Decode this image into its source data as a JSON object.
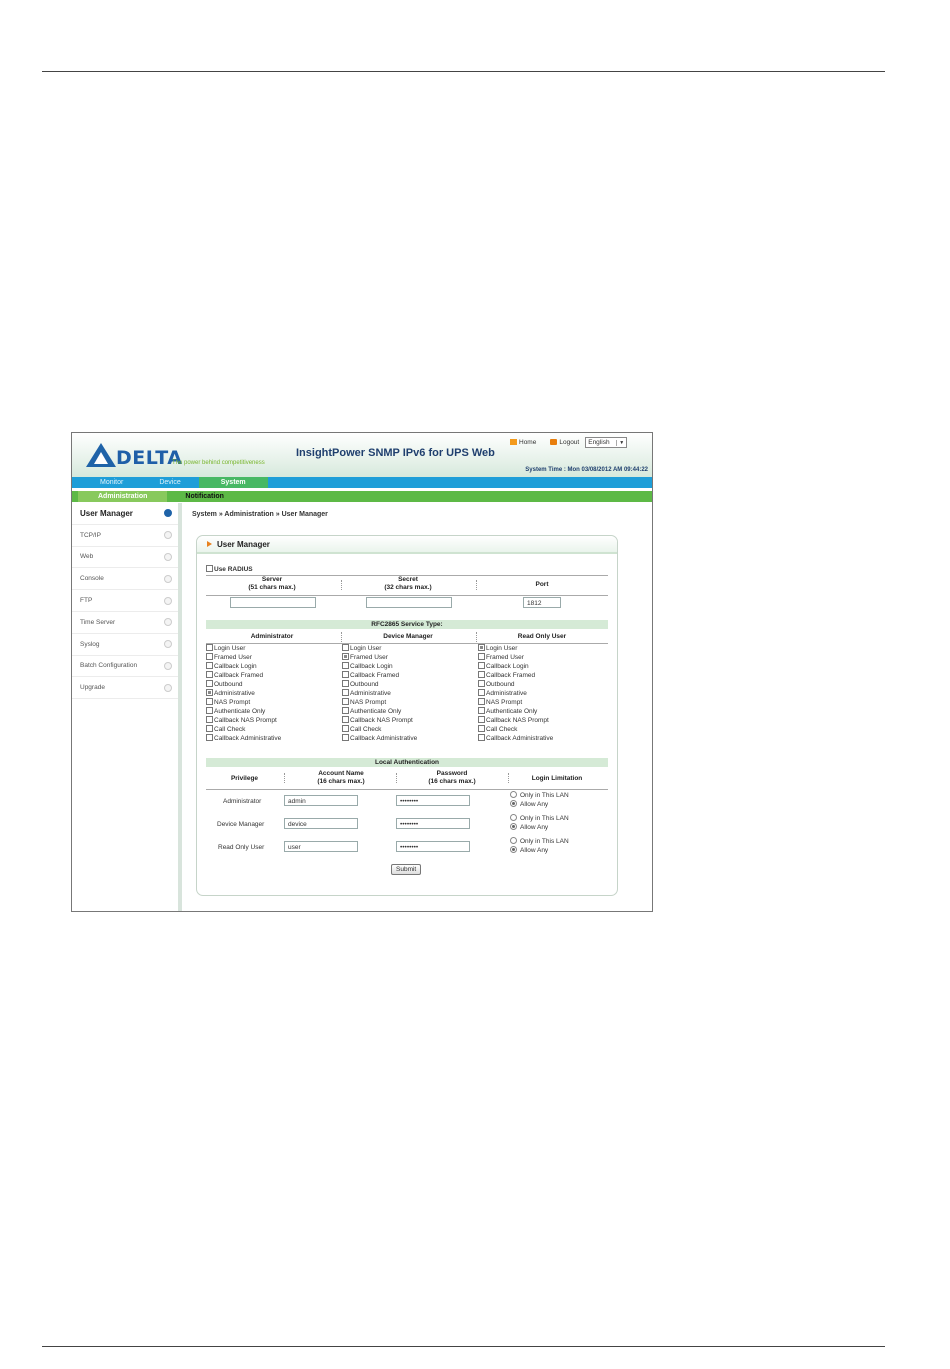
{
  "header": {
    "logo_text": "DELTA",
    "tagline": "The power behind competitiveness",
    "app_title": "InsightPower SNMP IPv6 for UPS Web",
    "home_label": "Home",
    "logout_label": "Logout",
    "language": "English",
    "system_time": "System Time : Mon 03/08/2012 AM 09:44:22"
  },
  "nav": {
    "tabs": [
      "Monitor",
      "Device",
      "System"
    ],
    "subtabs": [
      "Administration",
      "Notification"
    ]
  },
  "sidebar": {
    "items": [
      "User Manager",
      "TCP/IP",
      "Web",
      "Console",
      "FTP",
      "Time Server",
      "Syslog",
      "Batch Configuration",
      "Upgrade"
    ]
  },
  "breadcrumb": "System » Administration » User Manager",
  "panel": {
    "title": "User Manager",
    "use_radius_label": "Use RADIUS",
    "server_header": "Server",
    "server_hint": "(51 chars max.)",
    "secret_header": "Secret",
    "secret_hint": "(32 chars max.)",
    "port_header": "Port",
    "port_value": "1812",
    "rfc_title": "RFC2865 Service Type:",
    "role_headers": [
      "Administrator",
      "Device Manager",
      "Read Only User"
    ],
    "service_types": [
      "Login User",
      "Framed User",
      "Callback Login",
      "Callback Framed",
      "Outbound",
      "Administrative",
      "NAS Prompt",
      "Authenticate Only",
      "Callback NAS Prompt",
      "Call Check",
      "Callback Administrative"
    ],
    "checked": {
      "Administrator": [
        "Administrative"
      ],
      "Device Manager": [
        "Framed User"
      ],
      "Read Only User": [
        "Login User"
      ]
    },
    "local_auth_title": "Local Authentication",
    "privilege_header": "Privilege",
    "account_header": "Account Name",
    "account_hint": "(16 chars max.)",
    "password_header": "Password",
    "password_hint": "(16 chars max.)",
    "limitation_header": "Login Limitation",
    "only_lan_label": "Only in This LAN",
    "allow_any_label": "Allow Any",
    "users": [
      {
        "privilege": "Administrator",
        "account": "admin",
        "password": "••••••••"
      },
      {
        "privilege": "Device Manager",
        "account": "device",
        "password": "••••••••"
      },
      {
        "privilege": "Read Only User",
        "account": "user",
        "password": "••••••••"
      }
    ],
    "submit_label": "Submit"
  }
}
